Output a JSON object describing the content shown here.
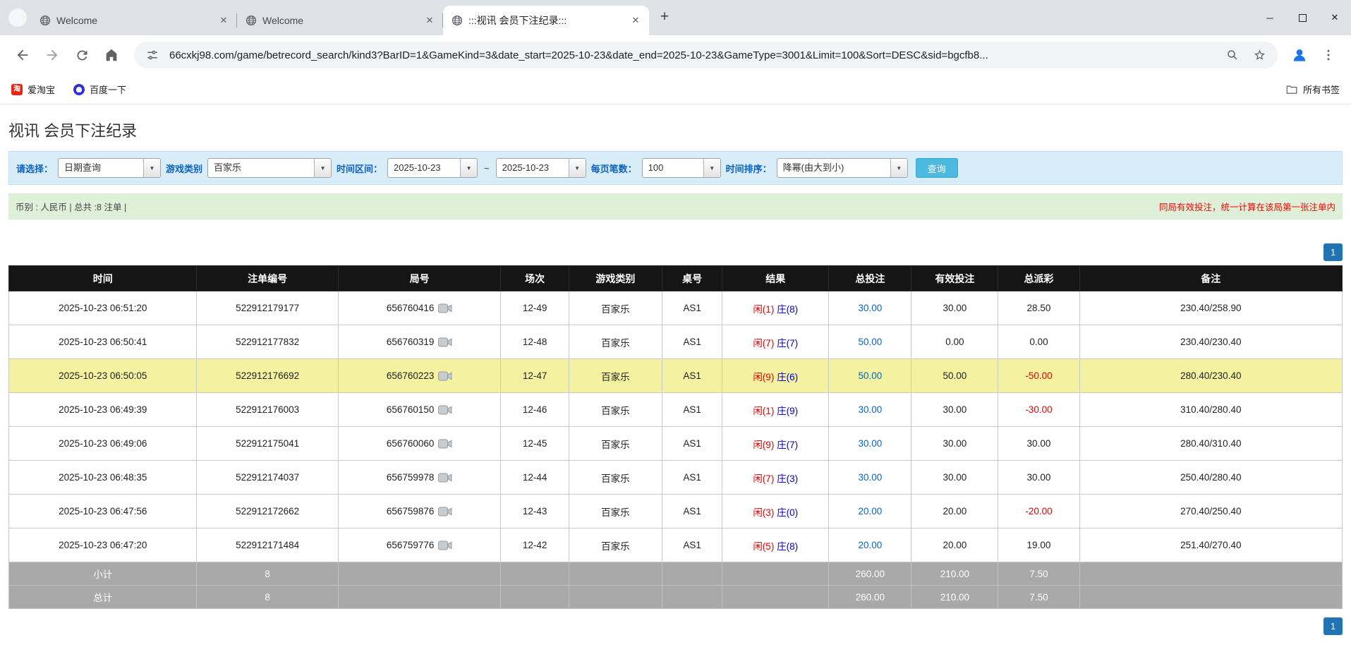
{
  "browser": {
    "tabs": [
      {
        "label": "Welcome"
      },
      {
        "label": "Welcome"
      },
      {
        "label": ":::视讯 会员下注纪录:::"
      }
    ],
    "new_tab_label": "+",
    "url": "66cxkj98.com/game/betrecord_search/kind3?BarID=1&GameKind=3&date_start=2025-10-23&date_end=2025-10-23&GameType=3001&Limit=100&Sort=DESC&sid=bgcfb8...",
    "bookmarks": [
      {
        "label": "爱淘宝"
      },
      {
        "label": "百度一下"
      }
    ],
    "all_bookmarks_label": "所有书签"
  },
  "page": {
    "title": "视讯 会员下注纪录",
    "filters": {
      "select_label": "请选择：",
      "select_value": "日期查询",
      "game_type_label": "游戏类别",
      "game_type_value": "百家乐",
      "range_label": "时间区间：",
      "date_start": "2025-10-23",
      "range_separator": "~",
      "date_end": "2025-10-23",
      "per_page_label": "每页笔数：",
      "per_page_value": "100",
      "sort_label": "时间排序：",
      "sort_value": "降幂(由大到小)",
      "query_button": "查询"
    },
    "summary": {
      "currency_info": "币别 : 人民币 | 总共 :8 注单 |",
      "note": "同局有效投注，统一计算在该局第一张注单内"
    },
    "pagination": {
      "page": "1"
    },
    "table": {
      "headers": [
        "时间",
        "注单编号",
        "局号",
        "场次",
        "游戏类别",
        "桌号",
        "结果",
        "总投注",
        "有效投注",
        "总派彩",
        "备注"
      ],
      "rows": [
        {
          "time": "2025-10-23 06:51:20",
          "bet_id": "522912179177",
          "round_id": "656760416",
          "session": "12-49",
          "game": "百家乐",
          "table_no": "AS1",
          "player": "闲(1)",
          "banker": "庄(8)",
          "total_bet": "30.00",
          "valid_bet": "30.00",
          "payout": "28.50",
          "remark": "230.40/258.90",
          "highlight": false
        },
        {
          "time": "2025-10-23 06:50:41",
          "bet_id": "522912177832",
          "round_id": "656760319",
          "session": "12-48",
          "game": "百家乐",
          "table_no": "AS1",
          "player": "闲(7)",
          "banker": "庄(7)",
          "total_bet": "50.00",
          "valid_bet": "0.00",
          "payout": "0.00",
          "remark": "230.40/230.40",
          "highlight": false
        },
        {
          "time": "2025-10-23 06:50:05",
          "bet_id": "522912176692",
          "round_id": "656760223",
          "session": "12-47",
          "game": "百家乐",
          "table_no": "AS1",
          "player": "闲(9)",
          "banker": "庄(6)",
          "total_bet": "50.00",
          "valid_bet": "50.00",
          "payout": "-50.00",
          "remark": "280.40/230.40",
          "highlight": true
        },
        {
          "time": "2025-10-23 06:49:39",
          "bet_id": "522912176003",
          "round_id": "656760150",
          "session": "12-46",
          "game": "百家乐",
          "table_no": "AS1",
          "player": "闲(1)",
          "banker": "庄(9)",
          "total_bet": "30.00",
          "valid_bet": "30.00",
          "payout": "-30.00",
          "remark": "310.40/280.40",
          "highlight": false
        },
        {
          "time": "2025-10-23 06:49:06",
          "bet_id": "522912175041",
          "round_id": "656760060",
          "session": "12-45",
          "game": "百家乐",
          "table_no": "AS1",
          "player": "闲(9)",
          "banker": "庄(7)",
          "total_bet": "30.00",
          "valid_bet": "30.00",
          "payout": "30.00",
          "remark": "280.40/310.40",
          "highlight": false
        },
        {
          "time": "2025-10-23 06:48:35",
          "bet_id": "522912174037",
          "round_id": "656759978",
          "session": "12-44",
          "game": "百家乐",
          "table_no": "AS1",
          "player": "闲(7)",
          "banker": "庄(3)",
          "total_bet": "30.00",
          "valid_bet": "30.00",
          "payout": "30.00",
          "remark": "250.40/280.40",
          "highlight": false
        },
        {
          "time": "2025-10-23 06:47:56",
          "bet_id": "522912172662",
          "round_id": "656759876",
          "session": "12-43",
          "game": "百家乐",
          "table_no": "AS1",
          "player": "闲(3)",
          "banker": "庄(0)",
          "total_bet": "20.00",
          "valid_bet": "20.00",
          "payout": "-20.00",
          "remark": "270.40/250.40",
          "highlight": false
        },
        {
          "time": "2025-10-23 06:47:20",
          "bet_id": "522912171484",
          "round_id": "656759776",
          "session": "12-42",
          "game": "百家乐",
          "table_no": "AS1",
          "player": "闲(5)",
          "banker": "庄(8)",
          "total_bet": "20.00",
          "valid_bet": "20.00",
          "payout": "19.00",
          "remark": "251.40/270.40",
          "highlight": false
        }
      ],
      "subtotal": {
        "label": "小计",
        "count": "8",
        "total_bet": "260.00",
        "valid_bet": "210.00",
        "payout": "7.50"
      },
      "total": {
        "label": "总计",
        "count": "8",
        "total_bet": "260.00",
        "valid_bet": "210.00",
        "payout": "7.50"
      }
    }
  },
  "colors": {
    "player_text": "#e60000",
    "banker_text": "#0000cc",
    "link": "#0066cc",
    "negative": "#e60000",
    "highlight_row": "#f4f1a1",
    "header_bg": "#151515",
    "footer_bg": "#a9a9a9",
    "filter_bg": "#d9edf8",
    "summary_bg": "#dff0d8",
    "query_button_bg": "#4cb9de",
    "pager_bg": "#2173b4"
  }
}
